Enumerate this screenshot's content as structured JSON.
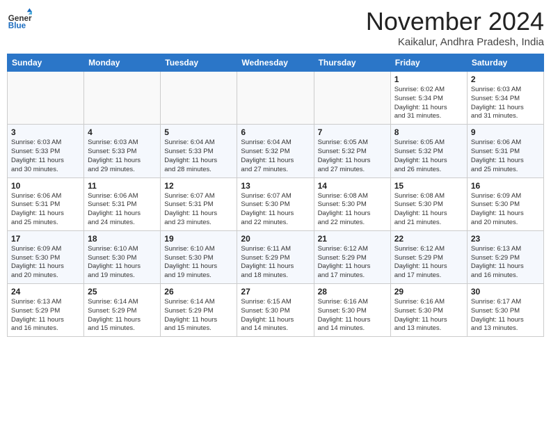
{
  "logo": {
    "general": "General",
    "blue": "Blue"
  },
  "header": {
    "month": "November 2024",
    "location": "Kaikalur, Andhra Pradesh, India"
  },
  "weekdays": [
    "Sunday",
    "Monday",
    "Tuesday",
    "Wednesday",
    "Thursday",
    "Friday",
    "Saturday"
  ],
  "weeks": [
    [
      {
        "day": "",
        "info": ""
      },
      {
        "day": "",
        "info": ""
      },
      {
        "day": "",
        "info": ""
      },
      {
        "day": "",
        "info": ""
      },
      {
        "day": "",
        "info": ""
      },
      {
        "day": "1",
        "info": "Sunrise: 6:02 AM\nSunset: 5:34 PM\nDaylight: 11 hours\nand 31 minutes."
      },
      {
        "day": "2",
        "info": "Sunrise: 6:03 AM\nSunset: 5:34 PM\nDaylight: 11 hours\nand 31 minutes."
      }
    ],
    [
      {
        "day": "3",
        "info": "Sunrise: 6:03 AM\nSunset: 5:33 PM\nDaylight: 11 hours\nand 30 minutes."
      },
      {
        "day": "4",
        "info": "Sunrise: 6:03 AM\nSunset: 5:33 PM\nDaylight: 11 hours\nand 29 minutes."
      },
      {
        "day": "5",
        "info": "Sunrise: 6:04 AM\nSunset: 5:33 PM\nDaylight: 11 hours\nand 28 minutes."
      },
      {
        "day": "6",
        "info": "Sunrise: 6:04 AM\nSunset: 5:32 PM\nDaylight: 11 hours\nand 27 minutes."
      },
      {
        "day": "7",
        "info": "Sunrise: 6:05 AM\nSunset: 5:32 PM\nDaylight: 11 hours\nand 27 minutes."
      },
      {
        "day": "8",
        "info": "Sunrise: 6:05 AM\nSunset: 5:32 PM\nDaylight: 11 hours\nand 26 minutes."
      },
      {
        "day": "9",
        "info": "Sunrise: 6:06 AM\nSunset: 5:31 PM\nDaylight: 11 hours\nand 25 minutes."
      }
    ],
    [
      {
        "day": "10",
        "info": "Sunrise: 6:06 AM\nSunset: 5:31 PM\nDaylight: 11 hours\nand 25 minutes."
      },
      {
        "day": "11",
        "info": "Sunrise: 6:06 AM\nSunset: 5:31 PM\nDaylight: 11 hours\nand 24 minutes."
      },
      {
        "day": "12",
        "info": "Sunrise: 6:07 AM\nSunset: 5:31 PM\nDaylight: 11 hours\nand 23 minutes."
      },
      {
        "day": "13",
        "info": "Sunrise: 6:07 AM\nSunset: 5:30 PM\nDaylight: 11 hours\nand 22 minutes."
      },
      {
        "day": "14",
        "info": "Sunrise: 6:08 AM\nSunset: 5:30 PM\nDaylight: 11 hours\nand 22 minutes."
      },
      {
        "day": "15",
        "info": "Sunrise: 6:08 AM\nSunset: 5:30 PM\nDaylight: 11 hours\nand 21 minutes."
      },
      {
        "day": "16",
        "info": "Sunrise: 6:09 AM\nSunset: 5:30 PM\nDaylight: 11 hours\nand 20 minutes."
      }
    ],
    [
      {
        "day": "17",
        "info": "Sunrise: 6:09 AM\nSunset: 5:30 PM\nDaylight: 11 hours\nand 20 minutes."
      },
      {
        "day": "18",
        "info": "Sunrise: 6:10 AM\nSunset: 5:30 PM\nDaylight: 11 hours\nand 19 minutes."
      },
      {
        "day": "19",
        "info": "Sunrise: 6:10 AM\nSunset: 5:30 PM\nDaylight: 11 hours\nand 19 minutes."
      },
      {
        "day": "20",
        "info": "Sunrise: 6:11 AM\nSunset: 5:29 PM\nDaylight: 11 hours\nand 18 minutes."
      },
      {
        "day": "21",
        "info": "Sunrise: 6:12 AM\nSunset: 5:29 PM\nDaylight: 11 hours\nand 17 minutes."
      },
      {
        "day": "22",
        "info": "Sunrise: 6:12 AM\nSunset: 5:29 PM\nDaylight: 11 hours\nand 17 minutes."
      },
      {
        "day": "23",
        "info": "Sunrise: 6:13 AM\nSunset: 5:29 PM\nDaylight: 11 hours\nand 16 minutes."
      }
    ],
    [
      {
        "day": "24",
        "info": "Sunrise: 6:13 AM\nSunset: 5:29 PM\nDaylight: 11 hours\nand 16 minutes."
      },
      {
        "day": "25",
        "info": "Sunrise: 6:14 AM\nSunset: 5:29 PM\nDaylight: 11 hours\nand 15 minutes."
      },
      {
        "day": "26",
        "info": "Sunrise: 6:14 AM\nSunset: 5:29 PM\nDaylight: 11 hours\nand 15 minutes."
      },
      {
        "day": "27",
        "info": "Sunrise: 6:15 AM\nSunset: 5:30 PM\nDaylight: 11 hours\nand 14 minutes."
      },
      {
        "day": "28",
        "info": "Sunrise: 6:16 AM\nSunset: 5:30 PM\nDaylight: 11 hours\nand 14 minutes."
      },
      {
        "day": "29",
        "info": "Sunrise: 6:16 AM\nSunset: 5:30 PM\nDaylight: 11 hours\nand 13 minutes."
      },
      {
        "day": "30",
        "info": "Sunrise: 6:17 AM\nSunset: 5:30 PM\nDaylight: 11 hours\nand 13 minutes."
      }
    ]
  ]
}
